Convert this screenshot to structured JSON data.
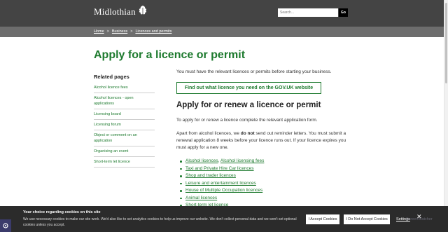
{
  "header": {
    "logo_text": "Midlothian",
    "search_placeholder": "Search...",
    "search_button": "Go"
  },
  "breadcrumb": [
    "Home",
    "Business",
    "Licences and permits"
  ],
  "page": {
    "title": "Apply for a licence or permit",
    "intro": "You must have the relevant licences or permits before starting your business.",
    "gov_button": "Find out what licence you need on the GOV.UK website",
    "section_heading": "Apply for or renew a licence or permit",
    "para1": "To apply for or renew a licence complete the relevant application form.",
    "para2_before": "Apart from alcohol licences, we ",
    "para2_bold": "do not",
    "para2_after": " send out reminder letters. You must submit a renewal application 8 weeks before your licence runs out. If your licence expires you must apply for a new one."
  },
  "related": {
    "heading": "Related pages",
    "items": [
      "Alcohol licence fees",
      "Alcohol licences - open applications",
      "Licensing board",
      "Licensing forum",
      "Object or comment on an application",
      "Organising an event",
      "Short-term let licence"
    ]
  },
  "licences": {
    "first_a": "Alcohol licences",
    "first_sep": ", ",
    "first_b": "Alcohol licensing fees",
    "items": [
      "Taxi and Private Hire Car licences",
      "Shop and trader licences",
      "Leisure and entertainment licences",
      "House of Multiple Occupation licences",
      "Animal licences",
      "Short-term let licence"
    ]
  },
  "cookie": {
    "title": "Your choice regarding cookies on this site",
    "body": "We use necessary cookies to make our site work. We'd also like to set analytics cookies to help us improve our website. We don't collect personal data and we won't set optional cookies unless you accept.",
    "accept": "I Accept Cookies",
    "reject": "I Do Not Accept Cookies",
    "settings": "Settings",
    "close": "✕"
  },
  "watermark": "ScreenWatcher"
}
